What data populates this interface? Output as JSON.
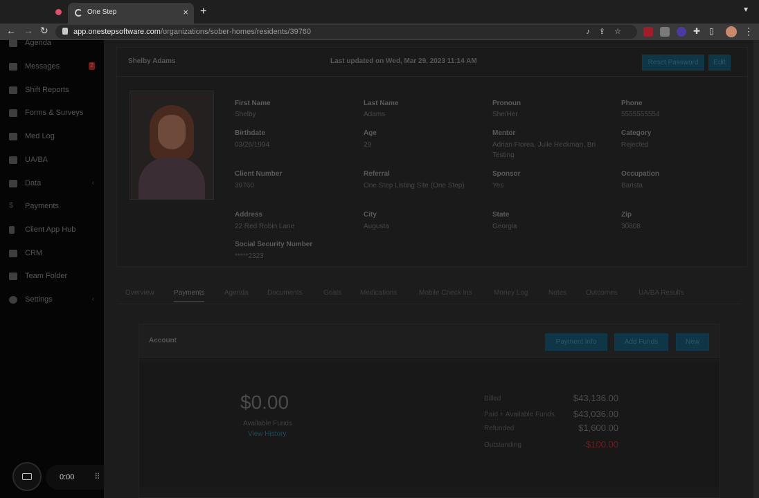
{
  "browser": {
    "tab_title": "One Step",
    "url_host": "app.onestepsoftware.com",
    "url_path": "/organizations/sober-homes/residents/39760"
  },
  "sidebar": {
    "items": [
      {
        "label": "Agenda",
        "icon": "calendar-icon"
      },
      {
        "label": "Messages",
        "icon": "envelope-icon",
        "badge": "2"
      },
      {
        "label": "Shift Reports",
        "icon": "flag-icon"
      },
      {
        "label": "Forms & Surveys",
        "icon": "form-icon"
      },
      {
        "label": "Med Log",
        "icon": "pill-icon"
      },
      {
        "label": "UA/BA",
        "icon": "clipboard-icon"
      },
      {
        "label": "Data",
        "icon": "database-icon",
        "has_submenu": true
      },
      {
        "label": "Payments",
        "icon": "dollar-icon"
      },
      {
        "label": "Client App Hub",
        "icon": "phone-icon"
      },
      {
        "label": "CRM",
        "icon": "megaphone-icon"
      },
      {
        "label": "Team Folder",
        "icon": "folder-icon"
      },
      {
        "label": "Settings",
        "icon": "gear-icon",
        "has_submenu": true
      }
    ]
  },
  "recorder": {
    "time": "0:00"
  },
  "resident": {
    "name": "Shelby Adams",
    "last_updated": "Last updated on Wed, Mar 29, 2023 11:14 AM",
    "reset_password_label": "Reset Password",
    "edit_label": "Edit",
    "fields": {
      "first_name": {
        "label": "First Name",
        "value": "Shelby"
      },
      "last_name": {
        "label": "Last Name",
        "value": "Adams"
      },
      "pronoun": {
        "label": "Pronoun",
        "value": "She/Her"
      },
      "phone": {
        "label": "Phone",
        "value": "5555555554"
      },
      "birthdate": {
        "label": "Birthdate",
        "value": "03/26/1994"
      },
      "age": {
        "label": "Age",
        "value": "29"
      },
      "mentor": {
        "label": "Mentor",
        "value": "Adrian Florea, Julie Heckman, Bri Testing"
      },
      "category": {
        "label": "Category",
        "value": "Rejected"
      },
      "client_number": {
        "label": "Client Number",
        "value": "39760"
      },
      "referral": {
        "label": "Referral",
        "value": "One Step Listing Site (One Step)"
      },
      "sponsor": {
        "label": "Sponsor",
        "value": "Yes"
      },
      "occupation": {
        "label": "Occupation",
        "value": "Barista"
      },
      "address": {
        "label": "Address",
        "value": "22 Red Robin Lane"
      },
      "city": {
        "label": "City",
        "value": "Augusta"
      },
      "state": {
        "label": "State",
        "value": "Georgia"
      },
      "zip": {
        "label": "Zip",
        "value": "30808"
      },
      "ssn": {
        "label": "Social Security Number",
        "value": "*****2323"
      }
    }
  },
  "tabs": [
    {
      "label": "Overview"
    },
    {
      "label": "Payments",
      "active": true
    },
    {
      "label": "Agenda"
    },
    {
      "label": "Documents"
    },
    {
      "label": "Goals"
    },
    {
      "label": "Medications"
    },
    {
      "label": "Mobile Check Ins"
    },
    {
      "label": "Money Log"
    },
    {
      "label": "Notes"
    },
    {
      "label": "Outcomes"
    },
    {
      "label": "UA/BA Results"
    }
  ],
  "account": {
    "title": "Account",
    "payment_info_label": "Payment Info",
    "add_funds_label": "Add Funds",
    "new_label": "New",
    "balance": "$0.00",
    "available_funds_label": "Available Funds",
    "view_history_label": "View History",
    "summary": {
      "billed_label": "Billed",
      "billed_value": "$43,136.00",
      "paid_label": "Paid + Available Funds",
      "paid_value": "$43,036.00",
      "refunded_label": "Refunded",
      "refunded_value": "$1,600.00",
      "outstanding_label": "Outstanding",
      "outstanding_value": "-$100.00"
    }
  },
  "colors": {
    "accent": "#17a2d4",
    "negative": "#dc3545"
  }
}
